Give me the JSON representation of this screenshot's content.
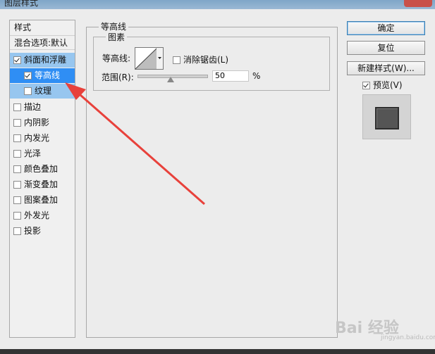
{
  "window": {
    "title": "图层样式"
  },
  "sidebar": {
    "header": "样式",
    "blending": "混合选项:默认",
    "items": [
      {
        "label": "斜面和浮雕",
        "checked": true
      },
      {
        "label": "等高线",
        "checked": true
      },
      {
        "label": "纹理",
        "checked": false
      },
      {
        "label": "描边",
        "checked": false
      },
      {
        "label": "内阴影",
        "checked": false
      },
      {
        "label": "内发光",
        "checked": false
      },
      {
        "label": "光泽",
        "checked": false
      },
      {
        "label": "颜色叠加",
        "checked": false
      },
      {
        "label": "渐变叠加",
        "checked": false
      },
      {
        "label": "图案叠加",
        "checked": false
      },
      {
        "label": "外发光",
        "checked": false
      },
      {
        "label": "投影",
        "checked": false
      }
    ]
  },
  "panel": {
    "title": "等高线",
    "group": "图素",
    "contour_label": "等高线:",
    "antialias_label": "消除锯齿(L)",
    "antialias_checked": false,
    "range_label": "范围(R):",
    "range_value": "50",
    "range_unit": "%",
    "range_fraction": 0.5
  },
  "buttons": {
    "ok": "确定",
    "reset": "复位",
    "new_style": "新建样式(W)...",
    "preview_label": "预览(V)",
    "preview_checked": true
  },
  "watermark": {
    "brand": "Bai 经验",
    "sub": "jingyan.baidu.com"
  },
  "colors": {
    "selection": "#2f8ef4",
    "selection_light": "#97c6ef",
    "arrow": "#e8413b"
  }
}
